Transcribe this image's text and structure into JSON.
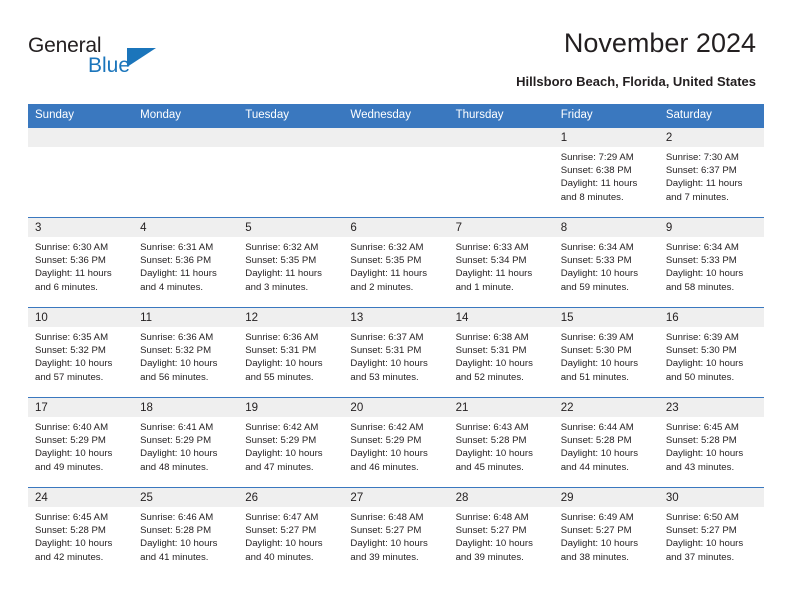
{
  "brand": {
    "name_part1": "General",
    "name_part2": "Blue",
    "accent_color": "#1b75bb"
  },
  "header": {
    "title": "November 2024",
    "location": "Hillsboro Beach, Florida, United States"
  },
  "theme": {
    "header_row_bg": "#3a78bf",
    "daynum_band_bg": "#efefef",
    "text_color": "#231f20"
  },
  "weekday_headers": [
    "Sunday",
    "Monday",
    "Tuesday",
    "Wednesday",
    "Thursday",
    "Friday",
    "Saturday"
  ],
  "weeks": [
    [
      {
        "empty": true
      },
      {
        "empty": true
      },
      {
        "empty": true
      },
      {
        "empty": true
      },
      {
        "empty": true
      },
      {
        "day": "1",
        "sunrise": "Sunrise: 7:29 AM",
        "sunset": "Sunset: 6:38 PM",
        "daylight": "Daylight: 11 hours and 8 minutes."
      },
      {
        "day": "2",
        "sunrise": "Sunrise: 7:30 AM",
        "sunset": "Sunset: 6:37 PM",
        "daylight": "Daylight: 11 hours and 7 minutes."
      }
    ],
    [
      {
        "day": "3",
        "sunrise": "Sunrise: 6:30 AM",
        "sunset": "Sunset: 5:36 PM",
        "daylight": "Daylight: 11 hours and 6 minutes."
      },
      {
        "day": "4",
        "sunrise": "Sunrise: 6:31 AM",
        "sunset": "Sunset: 5:36 PM",
        "daylight": "Daylight: 11 hours and 4 minutes."
      },
      {
        "day": "5",
        "sunrise": "Sunrise: 6:32 AM",
        "sunset": "Sunset: 5:35 PM",
        "daylight": "Daylight: 11 hours and 3 minutes."
      },
      {
        "day": "6",
        "sunrise": "Sunrise: 6:32 AM",
        "sunset": "Sunset: 5:35 PM",
        "daylight": "Daylight: 11 hours and 2 minutes."
      },
      {
        "day": "7",
        "sunrise": "Sunrise: 6:33 AM",
        "sunset": "Sunset: 5:34 PM",
        "daylight": "Daylight: 11 hours and 1 minute."
      },
      {
        "day": "8",
        "sunrise": "Sunrise: 6:34 AM",
        "sunset": "Sunset: 5:33 PM",
        "daylight": "Daylight: 10 hours and 59 minutes."
      },
      {
        "day": "9",
        "sunrise": "Sunrise: 6:34 AM",
        "sunset": "Sunset: 5:33 PM",
        "daylight": "Daylight: 10 hours and 58 minutes."
      }
    ],
    [
      {
        "day": "10",
        "sunrise": "Sunrise: 6:35 AM",
        "sunset": "Sunset: 5:32 PM",
        "daylight": "Daylight: 10 hours and 57 minutes."
      },
      {
        "day": "11",
        "sunrise": "Sunrise: 6:36 AM",
        "sunset": "Sunset: 5:32 PM",
        "daylight": "Daylight: 10 hours and 56 minutes."
      },
      {
        "day": "12",
        "sunrise": "Sunrise: 6:36 AM",
        "sunset": "Sunset: 5:31 PM",
        "daylight": "Daylight: 10 hours and 55 minutes."
      },
      {
        "day": "13",
        "sunrise": "Sunrise: 6:37 AM",
        "sunset": "Sunset: 5:31 PM",
        "daylight": "Daylight: 10 hours and 53 minutes."
      },
      {
        "day": "14",
        "sunrise": "Sunrise: 6:38 AM",
        "sunset": "Sunset: 5:31 PM",
        "daylight": "Daylight: 10 hours and 52 minutes."
      },
      {
        "day": "15",
        "sunrise": "Sunrise: 6:39 AM",
        "sunset": "Sunset: 5:30 PM",
        "daylight": "Daylight: 10 hours and 51 minutes."
      },
      {
        "day": "16",
        "sunrise": "Sunrise: 6:39 AM",
        "sunset": "Sunset: 5:30 PM",
        "daylight": "Daylight: 10 hours and 50 minutes."
      }
    ],
    [
      {
        "day": "17",
        "sunrise": "Sunrise: 6:40 AM",
        "sunset": "Sunset: 5:29 PM",
        "daylight": "Daylight: 10 hours and 49 minutes."
      },
      {
        "day": "18",
        "sunrise": "Sunrise: 6:41 AM",
        "sunset": "Sunset: 5:29 PM",
        "daylight": "Daylight: 10 hours and 48 minutes."
      },
      {
        "day": "19",
        "sunrise": "Sunrise: 6:42 AM",
        "sunset": "Sunset: 5:29 PM",
        "daylight": "Daylight: 10 hours and 47 minutes."
      },
      {
        "day": "20",
        "sunrise": "Sunrise: 6:42 AM",
        "sunset": "Sunset: 5:29 PM",
        "daylight": "Daylight: 10 hours and 46 minutes."
      },
      {
        "day": "21",
        "sunrise": "Sunrise: 6:43 AM",
        "sunset": "Sunset: 5:28 PM",
        "daylight": "Daylight: 10 hours and 45 minutes."
      },
      {
        "day": "22",
        "sunrise": "Sunrise: 6:44 AM",
        "sunset": "Sunset: 5:28 PM",
        "daylight": "Daylight: 10 hours and 44 minutes."
      },
      {
        "day": "23",
        "sunrise": "Sunrise: 6:45 AM",
        "sunset": "Sunset: 5:28 PM",
        "daylight": "Daylight: 10 hours and 43 minutes."
      }
    ],
    [
      {
        "day": "24",
        "sunrise": "Sunrise: 6:45 AM",
        "sunset": "Sunset: 5:28 PM",
        "daylight": "Daylight: 10 hours and 42 minutes."
      },
      {
        "day": "25",
        "sunrise": "Sunrise: 6:46 AM",
        "sunset": "Sunset: 5:28 PM",
        "daylight": "Daylight: 10 hours and 41 minutes."
      },
      {
        "day": "26",
        "sunrise": "Sunrise: 6:47 AM",
        "sunset": "Sunset: 5:27 PM",
        "daylight": "Daylight: 10 hours and 40 minutes."
      },
      {
        "day": "27",
        "sunrise": "Sunrise: 6:48 AM",
        "sunset": "Sunset: 5:27 PM",
        "daylight": "Daylight: 10 hours and 39 minutes."
      },
      {
        "day": "28",
        "sunrise": "Sunrise: 6:48 AM",
        "sunset": "Sunset: 5:27 PM",
        "daylight": "Daylight: 10 hours and 39 minutes."
      },
      {
        "day": "29",
        "sunrise": "Sunrise: 6:49 AM",
        "sunset": "Sunset: 5:27 PM",
        "daylight": "Daylight: 10 hours and 38 minutes."
      },
      {
        "day": "30",
        "sunrise": "Sunrise: 6:50 AM",
        "sunset": "Sunset: 5:27 PM",
        "daylight": "Daylight: 10 hours and 37 minutes."
      }
    ]
  ]
}
